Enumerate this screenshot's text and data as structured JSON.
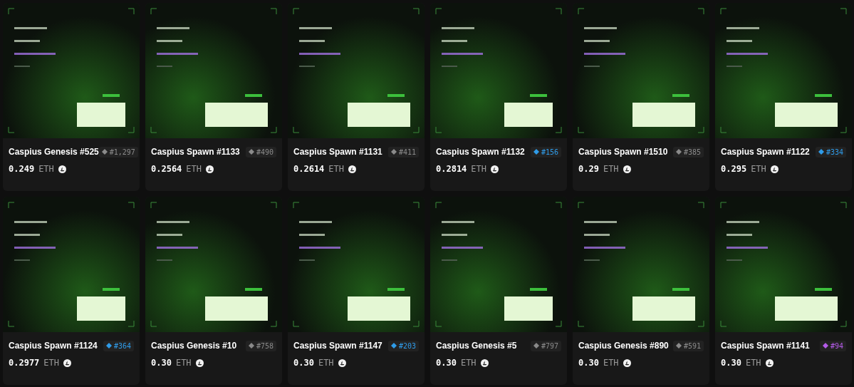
{
  "cards": [
    {
      "name": "Caspius Genesis #525",
      "rank": "#1,297",
      "color": "#8a8a8a",
      "price": "0.249",
      "currency": "ETH"
    },
    {
      "name": "Caspius Spawn #1133",
      "rank": "#490",
      "color": "#8a8a8a",
      "price": "0.2564",
      "currency": "ETH"
    },
    {
      "name": "Caspius Spawn #1131",
      "rank": "#411",
      "color": "#8a8a8a",
      "price": "0.2614",
      "currency": "ETH"
    },
    {
      "name": "Caspius Spawn #1132",
      "rank": "#156",
      "color": "#2f9be8",
      "price": "0.2814",
      "currency": "ETH"
    },
    {
      "name": "Caspius Spawn #1510",
      "rank": "#385",
      "color": "#8a8a8a",
      "price": "0.29",
      "currency": "ETH"
    },
    {
      "name": "Caspius Spawn #1122",
      "rank": "#334",
      "color": "#2f9be8",
      "price": "0.295",
      "currency": "ETH"
    },
    {
      "name": "Caspius Spawn #1124",
      "rank": "#364",
      "color": "#2f9be8",
      "price": "0.2977",
      "currency": "ETH"
    },
    {
      "name": "Caspius Genesis #10",
      "rank": "#758",
      "color": "#8a8a8a",
      "price": "0.30",
      "currency": "ETH"
    },
    {
      "name": "Caspius Spawn #1147",
      "rank": "#203",
      "color": "#2f9be8",
      "price": "0.30",
      "currency": "ETH"
    },
    {
      "name": "Caspius Genesis #5",
      "rank": "#797",
      "color": "#8a8a8a",
      "price": "0.30",
      "currency": "ETH"
    },
    {
      "name": "Caspius Genesis #890",
      "rank": "#591",
      "color": "#8a8a8a",
      "price": "0.30",
      "currency": "ETH"
    },
    {
      "name": "Caspius Spawn #1141",
      "rank": "#94",
      "color": "#b45be8",
      "price": "0.30",
      "currency": "ETH"
    }
  ]
}
